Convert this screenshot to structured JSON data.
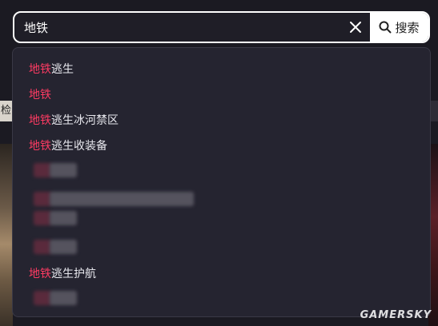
{
  "search": {
    "query": "地铁",
    "button_label": "搜索"
  },
  "background": {
    "left_label": "检"
  },
  "suggestions": [
    {
      "prefix": "地铁",
      "rest": "逃生"
    },
    {
      "prefix": "地铁",
      "rest": ""
    },
    {
      "prefix": "地铁",
      "rest": "逃生冰河禁区"
    },
    {
      "prefix": "地铁",
      "rest": "逃生收装备"
    },
    {
      "prefix": "地铁",
      "rest": "逃生护航"
    }
  ],
  "watermark": "GAMERSKY",
  "colors": {
    "highlight": "#ff3b63",
    "dropdown_bg": "#252430",
    "page_bg": "#1b1a22"
  }
}
